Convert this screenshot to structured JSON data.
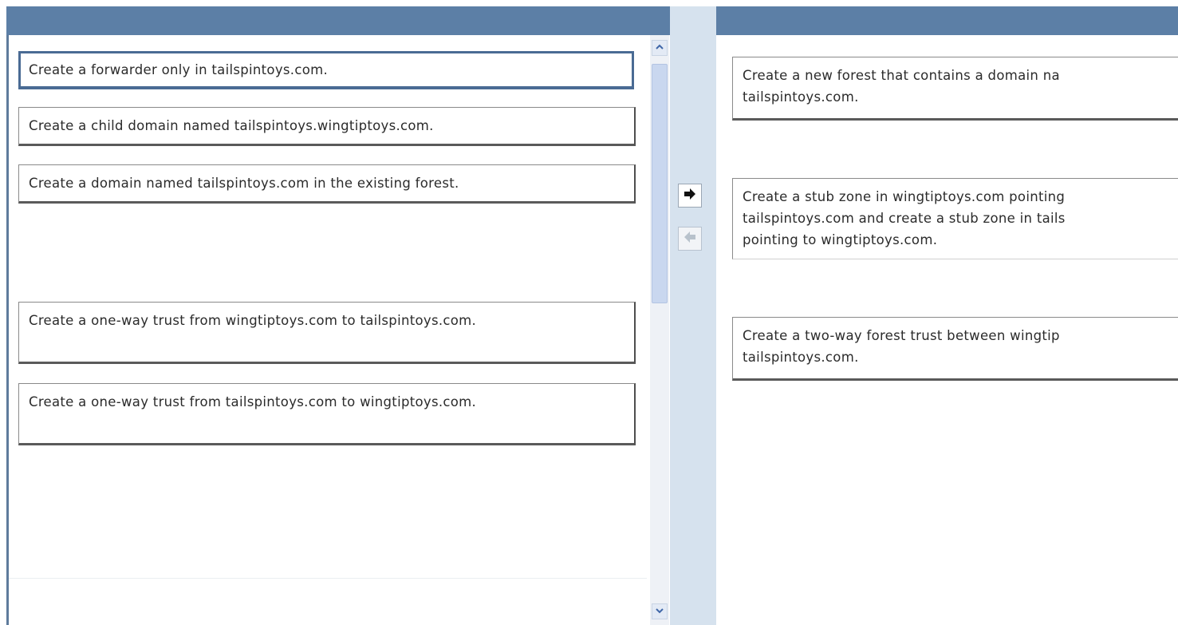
{
  "left_list": {
    "items": [
      {
        "label": "Create a forwarder only in tailspintoys.com."
      },
      {
        "label": "Create a child domain named tailspintoys.wingtiptoys.com."
      },
      {
        "label": "Create a domain named tailspintoys.com in the existing forest."
      },
      {
        "label": "Create a one-way trust from wingtiptoys.com to tailspintoys.com."
      },
      {
        "label": "Create a one-way trust from tailspintoys.com to wingtiptoys.com."
      }
    ]
  },
  "right_list": {
    "items": [
      {
        "lines": [
          "Create a new forest that contains a domain na",
          "tailspintoys.com."
        ]
      },
      {
        "lines": [
          "Create a stub zone in wingtiptoys.com pointing",
          "tailspintoys.com and create a stub zone in tails",
          "pointing to wingtiptoys.com."
        ]
      },
      {
        "lines": [
          "Create a two-way forest trust between wingtip",
          "tailspintoys.com."
        ]
      }
    ]
  },
  "controls": {
    "move_right_icon": "arrow-right-icon",
    "move_left_icon": "arrow-left-icon",
    "scroll_up_icon": "chevron-up-icon",
    "scroll_down_icon": "chevron-down-icon"
  },
  "colors": {
    "header": "#5c7fa6",
    "gutter": "#d6e2ee",
    "selected_border": "#4a6b94"
  }
}
